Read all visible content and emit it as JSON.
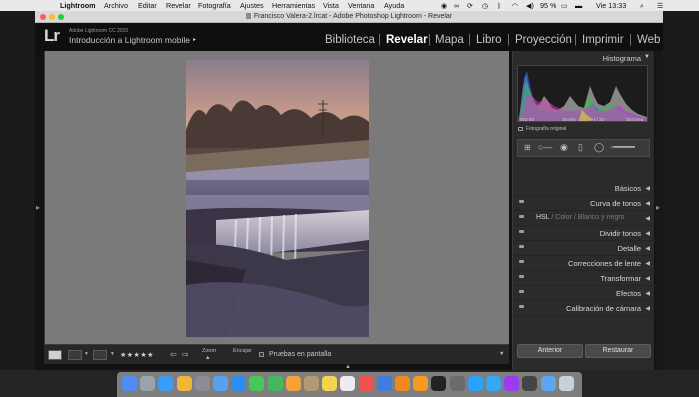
{
  "menubar": {
    "app": "Lightroom",
    "items": [
      "Archivo",
      "Editar",
      "Revelar",
      "Fotografía",
      "Ajustes",
      "Herramientas",
      "Vista",
      "Ventana",
      "Ayuda"
    ],
    "battery": "95 %",
    "clock": "Vie 13:33"
  },
  "window": {
    "title": "Francisco Valera-2.lrcat - Adobe Photoshop Lightroom - Revelar"
  },
  "identity": {
    "logo": "Lr",
    "version": "Adobe Lightroom CC 2015",
    "catalog": "Introducción a Lightroom mobile",
    "catalog_arrow": "▸"
  },
  "modules": [
    {
      "label": "Biblioteca",
      "active": false
    },
    {
      "label": "Revelar",
      "active": true
    },
    {
      "label": "Mapa",
      "active": false
    },
    {
      "label": "Libro",
      "active": false
    },
    {
      "label": "Proyección",
      "active": false
    },
    {
      "label": "Imprimir",
      "active": false
    },
    {
      "label": "Web",
      "active": false
    }
  ],
  "module_separator": "|",
  "toolbar": {
    "stars": "★★★★★",
    "zoom_label": "Zoom",
    "fit_label": "Encajar",
    "softproof_label": "Pruebas en pantalla"
  },
  "histogram": {
    "title": "Histograma",
    "arrow": "▼",
    "iso": "ISO 50",
    "focal": "18 mm",
    "aperture": "f / 22",
    "shutter": "15.0 seg",
    "original": "Fotografía original"
  },
  "sections": [
    {
      "label": "Básicos",
      "toggle": false
    },
    {
      "label": "Curva de tonos",
      "toggle": true
    },
    {
      "label": "HSL",
      "toggle": true,
      "hsl": true,
      "color": "Color",
      "bw": "Blanco y negro"
    },
    {
      "label": "Dividir tonos",
      "toggle": true
    },
    {
      "label": "Detalle",
      "toggle": true
    },
    {
      "label": "Correcciones de lente",
      "toggle": true
    },
    {
      "label": "Transformar",
      "toggle": true
    },
    {
      "label": "Efectos",
      "toggle": true
    },
    {
      "label": "Calibración de cámara",
      "toggle": true
    }
  ],
  "section_arrow": "◀",
  "buttons": {
    "previous": "Anterior",
    "reset": "Restaurar"
  },
  "colors": {
    "accent_active": "#ffffff",
    "panel_bg": "#2b2b2b",
    "canvas_bg": "#7a7a7a"
  },
  "dock": {
    "icons": [
      "finder-icon",
      "launchpad-icon",
      "safari-icon",
      "chrome-icon",
      "system-preferences-icon",
      "mail-icon",
      "app-store-icon",
      "messages-icon",
      "facetime-icon",
      "photos-icon",
      "contacts-icon",
      "notes-icon",
      "reminders-icon",
      "calendar-icon",
      "keynote-icon",
      "vlc-icon",
      "pages-icon",
      "quicktime-icon",
      "final-cut-icon",
      "photoshop-icon",
      "lightroom-icon",
      "premiere-icon",
      "activity-monitor-icon",
      "downloads-icon",
      "trash-icon"
    ]
  }
}
